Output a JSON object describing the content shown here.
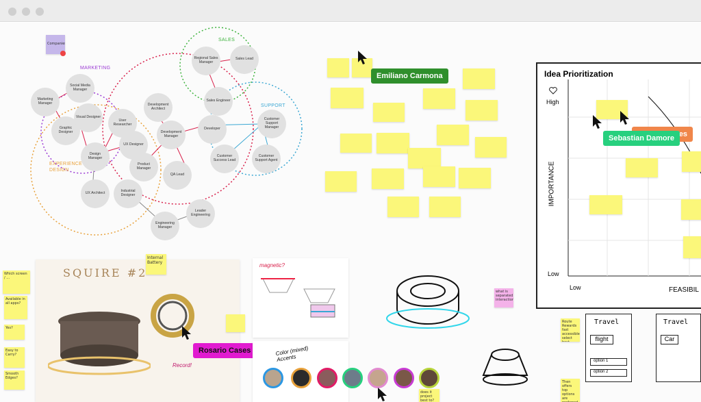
{
  "window": {
    "title": ""
  },
  "org_map": {
    "companies_sticky": "Companies",
    "clusters": {
      "marketing": "MARKETING",
      "sales": "SALES",
      "support": "SUPPORT",
      "experience_line1": "EXPERIENCE",
      "experience_line2": "DESIGN"
    },
    "nodes": {
      "social_media_manager": "Social Media Manager",
      "marketing_manager": "Marketing Manager",
      "graphic_designer": "Graphic Designer",
      "visual_designer": "Visual Designer",
      "user_researcher": "User Researcher",
      "design_manager": "Design Manager",
      "ux_designer": "UX Designer",
      "ux_architect": "UX Architect",
      "industrial_designer": "Industrial Designer",
      "development_architect": "Development Architect",
      "development_manager": "Development Manager",
      "product_manager": "Product Manager",
      "qa_lead": "QA Lead",
      "regional_sales_manager": "Regional Sales Manager",
      "sales_lead": "Sales Lead",
      "sales_engineer": "Sales Engineer",
      "developer": "Developer",
      "customer_support_manager": "Customer Support Manager",
      "customer_success_lead": "Customer Success Lead",
      "customer_support_agent": "Customer Support Agent",
      "engineering_manager": "Engineering Manager",
      "leader_engineering": "Leader Engineering"
    }
  },
  "collaborators": {
    "emiliano": "Emiliano Carmona",
    "sebastian": "Sebastian Damore",
    "rosario": "Rosario Cases Bocci",
    "hidden_tag": "des"
  },
  "prioritization": {
    "title": "Idea Prioritization",
    "y_axis": "IMPORTANCE",
    "x_axis": "FEASIBIL",
    "y_high": "High",
    "y_low": "Low",
    "x_low": "Low",
    "heart_icon": "heart-icon"
  },
  "sketches": {
    "squire_title": "SQUIRE #2",
    "internal_battery": "Internal Battery",
    "magnetic": "magnetic?",
    "color_accents": "Color (mixed) Accents",
    "record": "Record!",
    "separated_interaction": "what is separated interaction?",
    "which_product": "does it project best to?"
  },
  "side_stickies": [
    "Which screen / ...",
    "Available in all apps?",
    "Yes?",
    "Easy to Carry?",
    "Smooth Edges?"
  ],
  "travel": {
    "card1_title": "Travel",
    "card2_title": "Travel",
    "flight": "flight",
    "car": "Car",
    "option1": "option 1",
    "option2": "option 2",
    "note1": "Route Rewards fast accessible select best budget flight",
    "note2": "Then offers top options are preferred airlines"
  },
  "colors": {
    "sticky_yellow": "#fbf77a",
    "marketing": "#9b3bd4",
    "sales": "#3eb33e",
    "support": "#3aa7d3",
    "experience": "#e8a13a",
    "design_red": "#d81f4a",
    "emiliano_tag": "#2f8f2c",
    "sebastian_tag": "#27d07e",
    "rosario_tag": "#e11bd0"
  }
}
